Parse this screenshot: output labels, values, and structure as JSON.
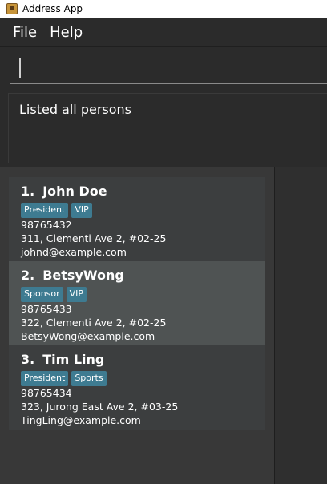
{
  "window": {
    "title": "Address App"
  },
  "menu": {
    "file": "File",
    "help": "Help"
  },
  "command": {
    "value": ""
  },
  "result": {
    "text": "Listed all persons"
  },
  "persons": [
    {
      "index": "1.",
      "name": "John Doe",
      "tags": [
        "President",
        "VIP"
      ],
      "phone": "98765432",
      "address": "311, Clementi Ave 2, #02-25",
      "email": "johnd@example.com"
    },
    {
      "index": "2.",
      "name": "BetsyWong",
      "tags": [
        "Sponsor",
        "VIP"
      ],
      "phone": "98765433",
      "address": "322, Clementi Ave 2, #02-25",
      "email": "BetsyWong@example.com"
    },
    {
      "index": "3.",
      "name": "Tim Ling",
      "tags": [
        "President",
        "Sports"
      ],
      "phone": "98765434",
      "address": "323, Jurong East Ave 2, #03-25",
      "email": "TingLing@example.com"
    }
  ],
  "colors": {
    "tag": "#3e7b91",
    "background": "#2b2b2b",
    "card_even": "#3c3e3f",
    "card_odd": "#4f5353"
  },
  "icons": {
    "app": "address-book-icon"
  }
}
